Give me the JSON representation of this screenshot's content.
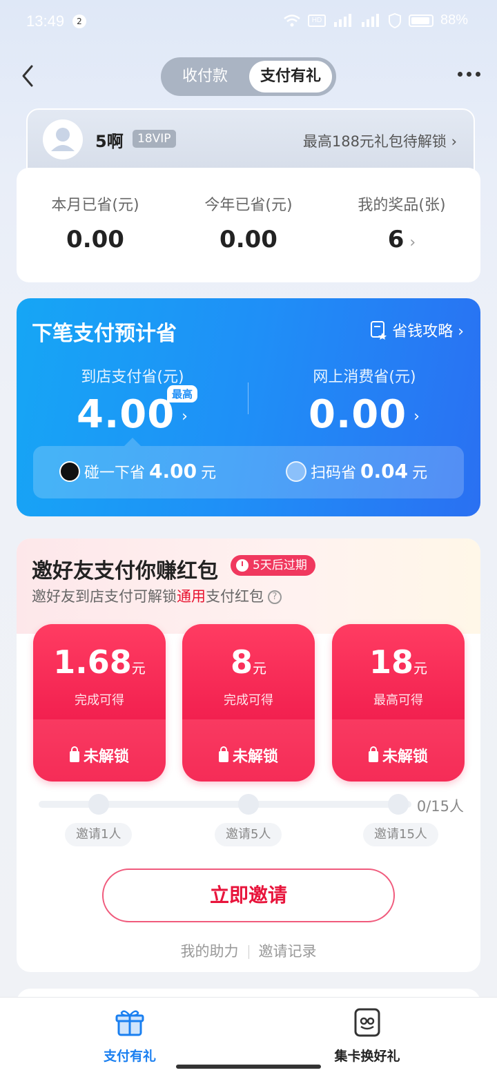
{
  "status_bar": {
    "time": "13:49",
    "notification_count": "2",
    "battery": "88%"
  },
  "header": {
    "tabs": [
      "收付款",
      "支付有礼"
    ],
    "active_tab": "支付有礼"
  },
  "profile": {
    "name": "5啊",
    "vip": "18VIP",
    "gift_text": "最高188元礼包待解锁 ›"
  },
  "savings": [
    {
      "label": "本月已省(元)",
      "value": "0.00"
    },
    {
      "label": "今年已省(元)",
      "value": "0.00"
    },
    {
      "label": "我的奖品(张)",
      "value": "6"
    }
  ],
  "next_payment": {
    "title": "下笔支付预计省",
    "tips_link": "省钱攻略 ›",
    "in_store_label": "到店支付省(元)",
    "in_store_value": "4.00",
    "max_tag": "最高",
    "online_label": "网上消费省(元)",
    "online_value": "0.00",
    "tap": {
      "label": "碰一下省",
      "amount": "4.00",
      "unit": "元"
    },
    "scan": {
      "label": "扫码省",
      "amount": "0.04",
      "unit": "元"
    }
  },
  "invite": {
    "title": "邀好友支付你赚红包",
    "expire": "5天后过期",
    "subtitle_before": "邀好友到店支付可解锁",
    "subtitle_highlight": "通用",
    "subtitle_after": "支付红包",
    "rewards": [
      {
        "amount": "1.68",
        "unit": "元",
        "desc": "完成可得",
        "status": "未解锁"
      },
      {
        "amount": "8",
        "unit": "元",
        "desc": "完成可得",
        "status": "未解锁"
      },
      {
        "amount": "18",
        "unit": "元",
        "desc": "最高可得",
        "status": "未解锁"
      }
    ],
    "progress_count": "0/15人",
    "progress": 0,
    "steps": [
      "邀请1人",
      "邀请5人",
      "邀请15人"
    ],
    "button": "立即邀请",
    "links": [
      "我的助力",
      "邀请记录"
    ]
  },
  "tab_bar": {
    "items": [
      {
        "label": "支付有礼",
        "icon": "gift-icon",
        "active": true
      },
      {
        "label": "集卡换好礼",
        "icon": "card-icon",
        "active": false
      }
    ],
    "active_color": "#1a7ff0"
  },
  "colors": {
    "accent_blue": "#1f8ff7",
    "accent_red": "#f52c57"
  }
}
